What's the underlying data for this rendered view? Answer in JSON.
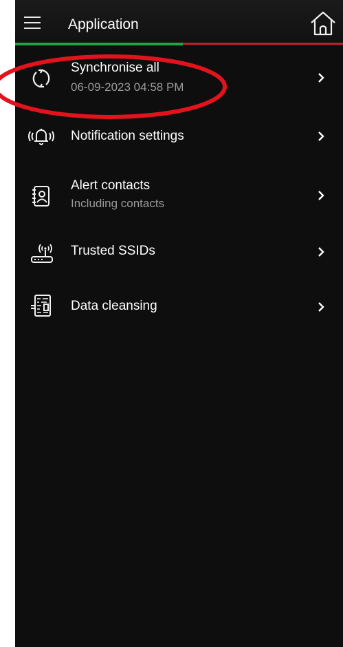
{
  "header": {
    "title": "Application",
    "menu_icon": "hamburger-menu-icon",
    "home_icon": "home-icon",
    "accent_green": "#25a244",
    "accent_red": "#c21e2b"
  },
  "items": [
    {
      "icon": "sync-icon",
      "title": "Synchronise all",
      "subtitle": "06-09-2023 04:58 PM"
    },
    {
      "icon": "bell-ringing-icon",
      "title": "Notification settings",
      "subtitle": ""
    },
    {
      "icon": "contact-book-icon",
      "title": "Alert contacts",
      "subtitle": "Including contacts"
    },
    {
      "icon": "router-wifi-icon",
      "title": "Trusted SSIDs",
      "subtitle": ""
    },
    {
      "icon": "data-cleansing-icon",
      "title": "Data cleansing",
      "subtitle": ""
    }
  ],
  "annotation": {
    "shape": "ellipse",
    "color": "#e3121c",
    "target": "Synchronise all"
  }
}
